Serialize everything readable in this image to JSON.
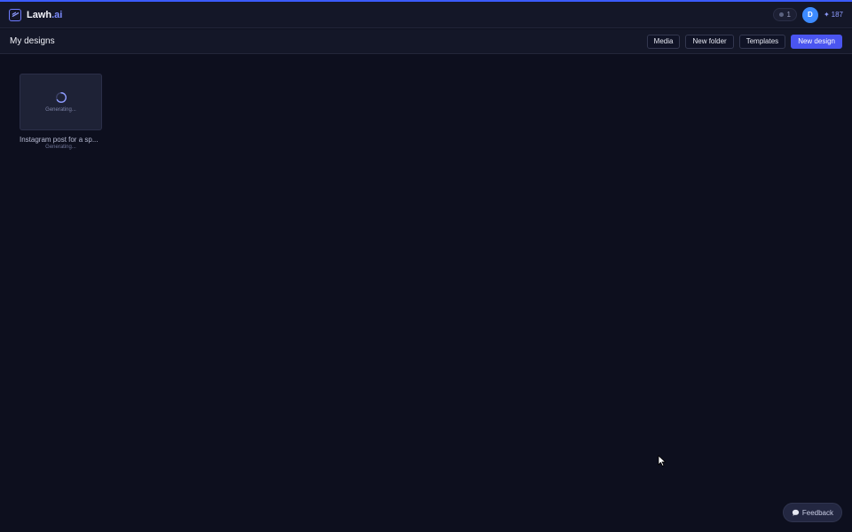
{
  "header": {
    "brand_name": "Lawh",
    "brand_suffix": ".ai",
    "notifications_count": "1",
    "avatar_initial": "D",
    "credits": "187"
  },
  "toolbar": {
    "title": "My designs",
    "media_label": "Media",
    "new_folder_label": "New folder",
    "templates_label": "Templates",
    "new_design_label": "New design"
  },
  "designs": [
    {
      "thumb_status": "Generating...",
      "title": "Instagram post for a sp...",
      "status": "Generating..."
    }
  ],
  "feedback": {
    "label": "Feedback"
  },
  "colors": {
    "background": "#0d0f1e",
    "header": "#141728",
    "accent": "#4a55f0",
    "avatar": "#3d8bff"
  }
}
